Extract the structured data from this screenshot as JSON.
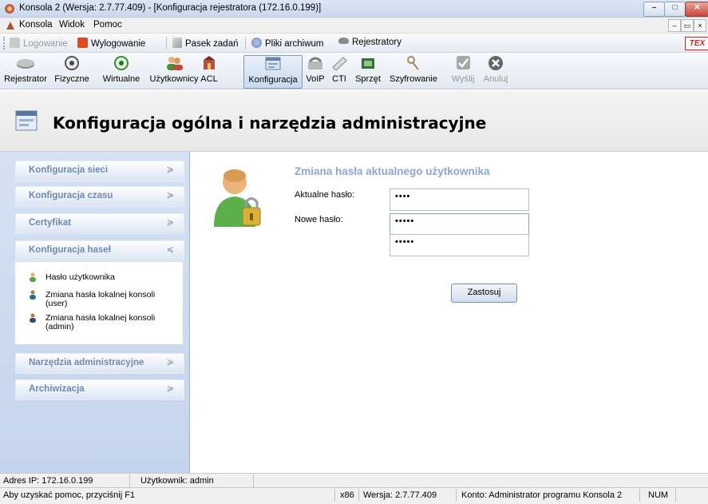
{
  "window": {
    "title": "Konsola 2 (Wersja: 2.7.77.409) - [Konfiguracja rejestratora (172.16.0.199)]"
  },
  "menubar": {
    "items": [
      "Konsola",
      "Widok",
      "Pomoc"
    ]
  },
  "toolbar1": {
    "login": "Logowanie",
    "logout": "Wylogowanie",
    "taskbar": "Pasek zadań",
    "archive_files": "Pliki archiwum",
    "recorders": "Rejestratory",
    "brand_logo": "TEX"
  },
  "toolbar2": {
    "buttons": [
      "Rejestrator",
      "Fizyczne",
      "Wirtualne",
      "Użytkownicy",
      "ACL",
      "Konfiguracja",
      "VoIP",
      "CTI",
      "Sprzęt",
      "Szyfrowanie",
      "Wyślij",
      "Anuluj"
    ]
  },
  "header": {
    "title": "Konfiguracja ogólna i narzędzia administracyjne"
  },
  "sidebar": {
    "sections": [
      {
        "label": "Konfiguracja sieci",
        "expanded": false
      },
      {
        "label": "Konfiguracja czasu",
        "expanded": false
      },
      {
        "label": "Certyfikat",
        "expanded": false
      },
      {
        "label": "Konfiguracja haseł",
        "expanded": true
      },
      {
        "label": "Narzędzia administracyjne",
        "expanded": false
      },
      {
        "label": "Archiwizacja",
        "expanded": false
      }
    ],
    "password_items": [
      "Hasło użytkownika",
      "Zmiana hasła lokalnej konsoli (user)",
      "Zmiana hasła lokalnej konsoli (admin)"
    ]
  },
  "main": {
    "title": "Zmiana hasła aktualnego użytkownika",
    "current_label": "Aktualne hasło:",
    "current_value": "••••",
    "new_label": "Nowe hasło:",
    "new_value": "•••••",
    "confirm_value": "•••••",
    "apply": "Zastosuj"
  },
  "status": {
    "ip": "Adres IP: 172.16.0.199",
    "user": "Użytkownik: admin",
    "help": "Aby uzyskać pomoc, przyciśnij F1",
    "arch": "x86",
    "version": "Wersja: 2.7.77.409",
    "account": "Konto: Administrator programu Konsola 2",
    "num": "NUM"
  },
  "colors": {
    "accent": "#8ea8cc",
    "sidebar_bg": "#c9d7ed",
    "sidebar_text": "#6f89b2"
  }
}
